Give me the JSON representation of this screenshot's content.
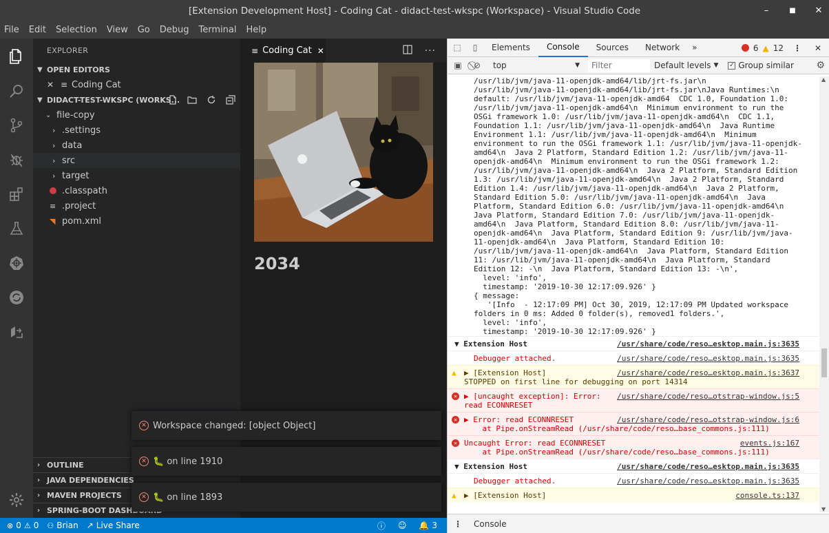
{
  "window": {
    "title": "[Extension Development Host] - Coding Cat - didact-test-wkspc (Workspace) - Visual Studio Code",
    "controls": [
      "–",
      "■",
      "✕"
    ]
  },
  "menu": [
    "File",
    "Edit",
    "Selection",
    "View",
    "Go",
    "Debug",
    "Terminal",
    "Help"
  ],
  "sidebar": {
    "title": "EXPLORER",
    "open_editors": "OPEN EDITORS",
    "open_editor_item": "Coding Cat",
    "workspace": "DIDACT-TEST-WKSPC (WORKS...",
    "tree": [
      {
        "label": "file-copy",
        "kind": "folder-open"
      },
      {
        "label": ".settings",
        "kind": "folder"
      },
      {
        "label": "data",
        "kind": "folder"
      },
      {
        "label": "src",
        "kind": "folder"
      },
      {
        "label": "target",
        "kind": "folder"
      },
      {
        "label": ".classpath",
        "kind": "file-classpath"
      },
      {
        "label": ".project",
        "kind": "file"
      },
      {
        "label": "pom.xml",
        "kind": "file-xml"
      }
    ],
    "bottom_sections": [
      "OUTLINE",
      "JAVA DEPENDENCIES",
      "MAVEN PROJECTS",
      "SPRING-BOOT DASHBOARD"
    ]
  },
  "editor": {
    "tab_label": "Coding Cat",
    "counter": "2034"
  },
  "notifications": [
    {
      "text": "Workspace changed: [object Object]"
    },
    {
      "text": "🐛 on line 1910"
    },
    {
      "text": "🐛 on line 1893"
    }
  ],
  "statusbar": {
    "errors": "0",
    "warnings": "0",
    "user": "Brian",
    "live_share": "Live Share",
    "bell_count": "3"
  },
  "devtools": {
    "tabs": [
      "Elements",
      "Console",
      "Sources",
      "Network"
    ],
    "active_tab": "Console",
    "error_count": "6",
    "warning_count": "12",
    "context": "top",
    "filter_placeholder": "Filter",
    "levels": "Default levels",
    "group_similar": "Group similar",
    "drawer_tab": "Console",
    "log_lines": [
      "/usr/lib/jvm/java-11-openjdk-amd64/lib/jrt-fs.jar\\n",
      "/usr/lib/jvm/java-11-openjdk-amd64/lib/jrt-fs.jar\\nJava Runtimes:\\n",
      "default: /usr/lib/jvm/java-11-openjdk-amd64  CDC 1.0, Foundation 1.0:",
      "/usr/lib/jvm/java-11-openjdk-amd64\\n  Minimum environment to run the",
      "OSGi framework 1.0: /usr/lib/jvm/java-11-openjdk-amd64\\n  CDC 1.1,",
      "Foundation 1.1: /usr/lib/jvm/java-11-openjdk-amd64\\n  Java Runtime",
      "Environment 1.1: /usr/lib/jvm/java-11-openjdk-amd64\\n  Minimum",
      "environment to run the OSGi framework 1.1: /usr/lib/jvm/java-11-openjdk-",
      "amd64\\n  Java 2 Platform, Standard Edition 1.2: /usr/lib/jvm/java-11-",
      "openjdk-amd64\\n  Minimum environment to run the OSGi framework 1.2:",
      "/usr/lib/jvm/java-11-openjdk-amd64\\n  Java 2 Platform, Standard Edition",
      "1.3: /usr/lib/jvm/java-11-openjdk-amd64\\n  Java 2 Platform, Standard",
      "Edition 1.4: /usr/lib/jvm/java-11-openjdk-amd64\\n  Java 2 Platform,",
      "Standard Edition 5.0: /usr/lib/jvm/java-11-openjdk-amd64\\n  Java",
      "Platform, Standard Edition 6.0: /usr/lib/jvm/java-11-openjdk-amd64\\n",
      "Java Platform, Standard Edition 7.0: /usr/lib/jvm/java-11-openjdk-",
      "amd64\\n  Java Platform, Standard Edition 8.0: /usr/lib/jvm/java-11-",
      "openjdk-amd64\\n  Java Platform, Standard Edition 9: /usr/lib/jvm/java-",
      "11-openjdk-amd64\\n  Java Platform, Standard Edition 10:",
      "/usr/lib/jvm/java-11-openjdk-amd64\\n  Java Platform, Standard Edition",
      "11: /usr/lib/jvm/java-11-openjdk-amd64\\n  Java Platform, Standard",
      "Edition 12: -\\n  Java Platform, Standard Edition 13: -\\n',",
      "  level: 'info',",
      "  timestamp: '2019-10-30 12:17:09.926' }",
      "{ message:",
      "   '[Info  - 12:17:09 PM] Oct 30, 2019, 12:17:09 PM Updated workspace",
      "folders in 0 ms: Added 0 folder(s), removed1 folders.',",
      "  level: 'info',",
      "  timestamp: '2019-10-30 12:17:09.926' }"
    ],
    "messages": [
      {
        "kind": "group",
        "text": "▼ Extension Host",
        "src": "/usr/share/code/reso…esktop.main.js:3635"
      },
      {
        "kind": "plain",
        "text": "Debugger attached.",
        "src": "/usr/share/code/reso…esktop.main.js:3635"
      },
      {
        "kind": "warn",
        "text": "▶ [Extension Host]\nSTOPPED on first line for debugging on port 14314",
        "src": "/usr/share/code/reso…esktop.main.js:3637"
      },
      {
        "kind": "err",
        "text": "▶ [uncaught exception]: Error:\nread ECONNRESET",
        "src": "/usr/share/code/reso…otstrap-window.js:5"
      },
      {
        "kind": "err",
        "text": "▶ Error: read ECONNRESET\n    at Pipe.onStreamRead (/usr/share/code/reso…base_commons.js:111)",
        "src": "/usr/share/code/reso…otstrap-window.js:6"
      },
      {
        "kind": "err",
        "text": "Uncaught Error: read ECONNRESET\n    at Pipe.onStreamRead (/usr/share/code/reso…base_commons.js:111)",
        "src": "events.js:167"
      },
      {
        "kind": "group",
        "text": "▼ Extension Host",
        "src": "/usr/share/code/reso…esktop.main.js:3635"
      },
      {
        "kind": "plain",
        "text": "Debugger attached.",
        "src": "/usr/share/code/reso…esktop.main.js:3635"
      },
      {
        "kind": "warn",
        "text": "▶ [Extension Host]",
        "src": "console.ts:137"
      }
    ]
  }
}
